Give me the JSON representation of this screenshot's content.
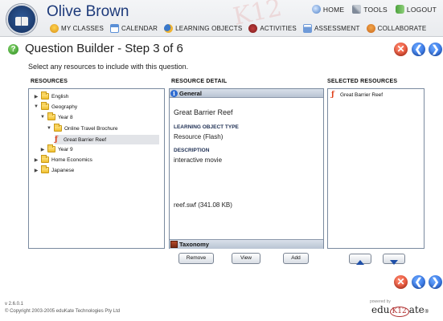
{
  "header": {
    "user_name": "Olive Brown",
    "watermark": "K12",
    "top_links": [
      {
        "label": "HOME",
        "icon": "home-icon"
      },
      {
        "label": "TOOLS",
        "icon": "tools-icon"
      },
      {
        "label": "LOGOUT",
        "icon": "logout-icon"
      }
    ],
    "nav": [
      {
        "label": "MY CLASSES",
        "icon": "classes-icon"
      },
      {
        "label": "CALENDAR",
        "icon": "calendar-icon"
      },
      {
        "label": "LEARNING OBJECTS",
        "icon": "learning-objects-icon"
      },
      {
        "label": "ACTIVITIES",
        "icon": "activities-icon"
      },
      {
        "label": "ASSESSMENT",
        "icon": "assessment-icon"
      },
      {
        "label": "COLLABORATE",
        "icon": "collaborate-icon"
      }
    ]
  },
  "page": {
    "title": "Question Builder - Step 3 of 6",
    "instructions": "Select any resources to include with this question.",
    "help_glyph": "?"
  },
  "columns": {
    "resources": "RESOURCES",
    "detail": "RESOURCE DETAIL",
    "selected": "SELECTED RESOURCES"
  },
  "tree": [
    {
      "label": "English",
      "expanded": false,
      "type": "folder"
    },
    {
      "label": "Geography",
      "expanded": true,
      "type": "folder"
    },
    {
      "label": "Year 8",
      "expanded": true,
      "type": "folder"
    },
    {
      "label": "Online Travel Brochure",
      "expanded": true,
      "type": "folder"
    },
    {
      "label": "Great Barrier Reef",
      "type": "flash",
      "selected": true
    },
    {
      "label": "Year 9",
      "expanded": false,
      "type": "folder"
    },
    {
      "label": "Home Economics",
      "expanded": false,
      "type": "folder"
    },
    {
      "label": "Japanese",
      "expanded": false,
      "type": "folder"
    }
  ],
  "detail": {
    "general_tab": "General",
    "name": "Great Barrier Reef",
    "type_label": "LEARNING OBJECT TYPE",
    "type_value": "Resource (Flash)",
    "desc_label": "DESCRIPTION",
    "desc_value": "interactive movie",
    "file": "reef.swf (341.08 KB)",
    "taxonomy_tab": "Taxonomy"
  },
  "selected_resources": [
    {
      "label": "Great Barrier Reef",
      "type": "flash"
    }
  ],
  "buttons": {
    "remove": "Remove",
    "view": "View",
    "add": "Add",
    "cancel_glyph": "✕",
    "back_glyph": "❮",
    "next_glyph": "❯"
  },
  "footer": {
    "version": "v 2.6.0.1",
    "copyright": "© Copyright 2003-2005 eduKate Technologies Pty Ltd",
    "powered_by": "powered by",
    "logo_edu": "edu",
    "logo_k12": "K12",
    "logo_ate": "ate"
  },
  "colors": {
    "header_bg": "#eceef1",
    "user_name": "#1d3a7a",
    "panel_border": "#7a8a9f",
    "cancel": "#d8341a",
    "nav_arrow": "#1c5bd6"
  }
}
